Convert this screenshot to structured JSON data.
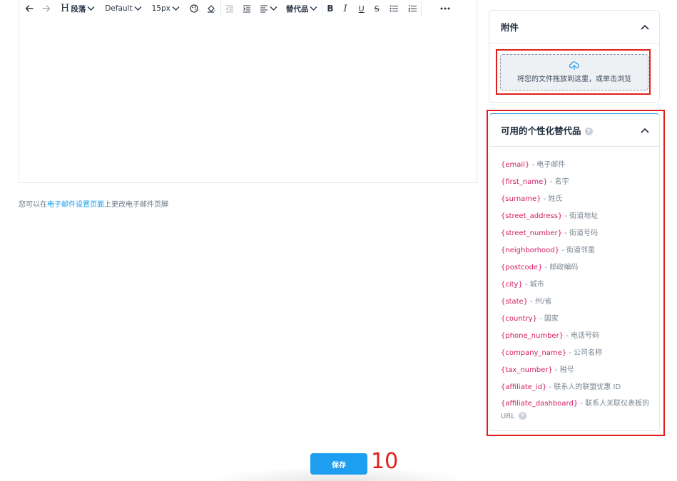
{
  "toolbar": {
    "heading_label": "段落",
    "font_label": "Default",
    "size_label": "15px",
    "placeholders_label": "替代品"
  },
  "footer": {
    "prefix": "您可以在",
    "link": "电子邮件设置页面",
    "suffix": "上更改电子邮件页脚"
  },
  "attachments": {
    "title": "附件",
    "drop_text": "将您的文件拖放到这里，或单击浏览"
  },
  "variables": {
    "title": "可用的个性化替代品",
    "items": [
      {
        "key": "{email}",
        "desc": " - 电子邮件"
      },
      {
        "key": "{first_name}",
        "desc": " - 名字"
      },
      {
        "key": "{surname}",
        "desc": " - 姓氏"
      },
      {
        "key": "{street_address}",
        "desc": " - 街道地址"
      },
      {
        "key": "{street_number}",
        "desc": " - 街道号码"
      },
      {
        "key": "{neighborhood}",
        "desc": " - 街道邻里"
      },
      {
        "key": "{postcode}",
        "desc": " - 邮政编码"
      },
      {
        "key": "{city}",
        "desc": " - 城市"
      },
      {
        "key": "{state}",
        "desc": " - 州/省"
      },
      {
        "key": "{country}",
        "desc": " - 国家"
      },
      {
        "key": "{phone_number}",
        "desc": " - 电话号码"
      },
      {
        "key": "{company_name}",
        "desc": " - 公司名称"
      },
      {
        "key": "{tax_number}",
        "desc": " - 税号"
      },
      {
        "key": "{affiliate_id}",
        "desc": " - 联系人的联盟优惠 ID"
      },
      {
        "key": "{affiliate_dashboard}",
        "desc": " - 联系人关联仪表板的 URL"
      }
    ]
  },
  "actions": {
    "save_label": "保存",
    "step_number": "10"
  },
  "colors": {
    "accent": "#1e9ef0",
    "variable_key": "#d31a63",
    "annotation_red": "#e0201b"
  }
}
